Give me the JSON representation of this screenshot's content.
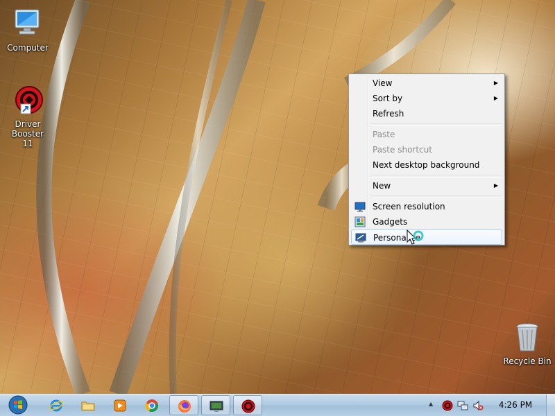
{
  "desktop": {
    "icons": [
      {
        "label": "Computer"
      },
      {
        "label_line1": "Driver Booster",
        "label_line2": "11"
      },
      {
        "label": "Recycle Bin"
      }
    ]
  },
  "context_menu": {
    "items": [
      {
        "label": "View",
        "submenu": true
      },
      {
        "label": "Sort by",
        "submenu": true
      },
      {
        "label": "Refresh"
      },
      {
        "label": "Paste",
        "disabled": true
      },
      {
        "label": "Paste shortcut",
        "disabled": true
      },
      {
        "label": "Next desktop background"
      },
      {
        "label": "New",
        "submenu": true
      },
      {
        "label": "Screen resolution",
        "icon": "screen-resolution-icon"
      },
      {
        "label": "Gadgets",
        "icon": "gadgets-icon"
      },
      {
        "label": "Personalize",
        "icon": "personalize-icon",
        "hovered": true
      }
    ],
    "submenu_glyph": "▶"
  },
  "taskbar": {
    "apps": [
      "internet-explorer-icon",
      "file-explorer-icon",
      "media-player-icon",
      "chrome-icon",
      "firefox-icon",
      "virtual-machine-icon",
      "driver-booster-icon"
    ],
    "tray": {
      "expand_glyph": "▲",
      "clock": "4:26 PM"
    }
  },
  "colors": {
    "menu_bg": "#f1f1f1",
    "menu_hover_border": "#aecff7",
    "taskbar": "#b1cbe1",
    "driver_booster_red": "#d3121b"
  }
}
